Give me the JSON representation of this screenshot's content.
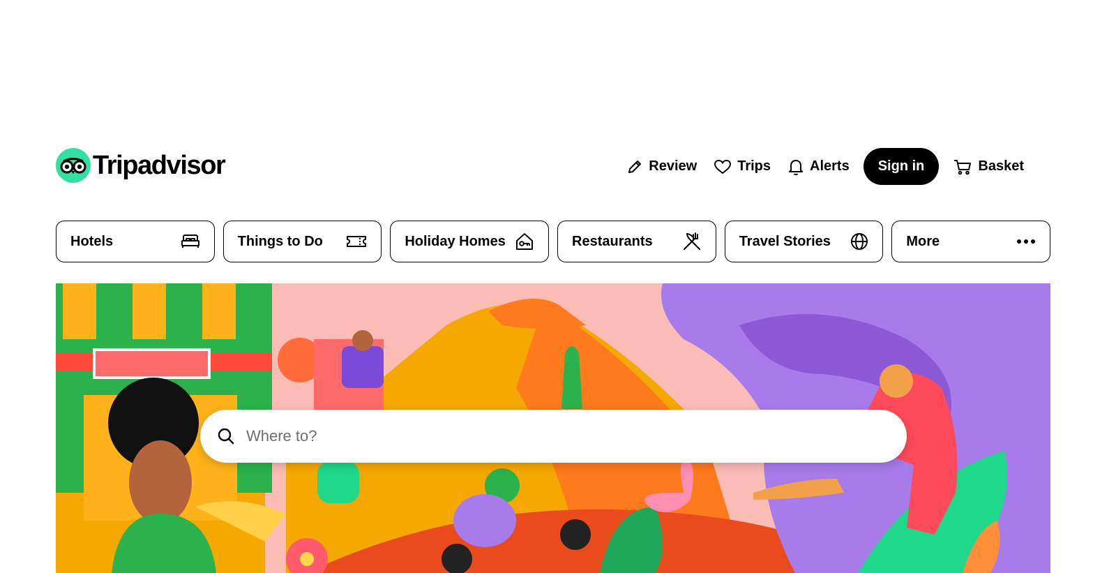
{
  "brand": {
    "name": "Tripadvisor",
    "accent": "#34e0a1"
  },
  "nav": {
    "review": "Review",
    "trips": "Trips",
    "alerts": "Alerts",
    "sign_in": "Sign in",
    "basket": "Basket"
  },
  "categories": [
    {
      "label": "Hotels",
      "icon": "bed-icon"
    },
    {
      "label": "Things to Do",
      "icon": "ticket-icon"
    },
    {
      "label": "Holiday Homes",
      "icon": "house-key-icon"
    },
    {
      "label": "Restaurants",
      "icon": "fork-knife-icon"
    },
    {
      "label": "Travel Stories",
      "icon": "globe-icon"
    },
    {
      "label": "More",
      "icon": "more-dots-icon"
    }
  ],
  "search": {
    "placeholder": "Where to?"
  },
  "hero": {
    "illustration": "colorful travel collage"
  }
}
